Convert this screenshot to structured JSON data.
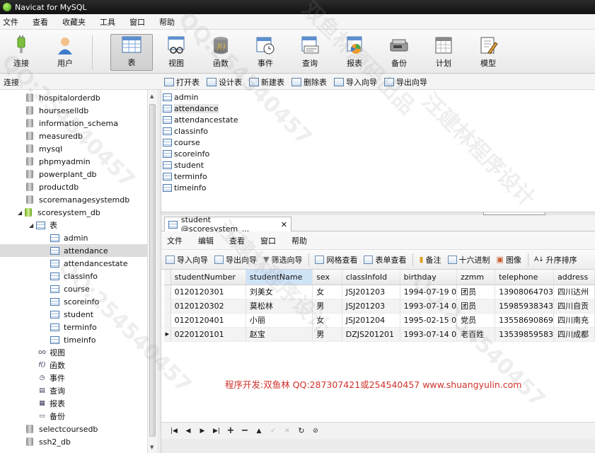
{
  "window": {
    "title": "Navicat for MySQL"
  },
  "menubar": [
    "文件",
    "查看",
    "收藏夹",
    "工具",
    "窗口",
    "帮助"
  ],
  "toolbar": [
    {
      "label": "连接",
      "icon": "plug-icon"
    },
    {
      "label": "用户",
      "icon": "user-icon"
    },
    {
      "label": "表",
      "icon": "table-icon",
      "active": true
    },
    {
      "label": "视图",
      "icon": "view-icon"
    },
    {
      "label": "函数",
      "icon": "function-icon"
    },
    {
      "label": "事件",
      "icon": "event-icon"
    },
    {
      "label": "查询",
      "icon": "query-icon"
    },
    {
      "label": "报表",
      "icon": "report-icon"
    },
    {
      "label": "备份",
      "icon": "backup-icon"
    },
    {
      "label": "计划",
      "icon": "schedule-icon"
    },
    {
      "label": "模型",
      "icon": "model-icon"
    }
  ],
  "left_header": "连接",
  "object_toolbar": [
    "打开表",
    "设计表",
    "新建表",
    "删除表",
    "导入向导",
    "导出向导"
  ],
  "tree": {
    "databases_top": [
      "hospitalorderdb",
      "hourseselldb",
      "information_schema",
      "measuredb",
      "mysql",
      "phpmyadmin",
      "powerplant_db",
      "productdb",
      "scoremanagesystemdb"
    ],
    "open_db": "scoresystem_db",
    "tables_node": "表",
    "tables": [
      "admin",
      "attendance",
      "attendancestate",
      "classinfo",
      "course",
      "scoreinfo",
      "student",
      "terminfo",
      "timeinfo"
    ],
    "selected_table": "attendance",
    "other_nodes": [
      {
        "label": "视图",
        "icon": "glasses-icon"
      },
      {
        "label": "函数",
        "icon": "function-icon"
      },
      {
        "label": "事件",
        "icon": "event-icon"
      },
      {
        "label": "查询",
        "icon": "query-icon"
      },
      {
        "label": "报表",
        "icon": "report-icon"
      },
      {
        "label": "备份",
        "icon": "backup-icon"
      }
    ],
    "databases_bottom": [
      "selectcoursedb",
      "ssh2_db"
    ]
  },
  "object_list": {
    "items": [
      "admin",
      "attendance",
      "attendancestate",
      "classinfo",
      "course",
      "scoreinfo",
      "student",
      "terminfo",
      "timeinfo"
    ],
    "selected": "attendance"
  },
  "inner_window": {
    "tab_title": "student @scoresystem_...",
    "menu": [
      "文件",
      "编辑",
      "查看",
      "窗口",
      "帮助"
    ],
    "toolbar": [
      "导入向导",
      "导出向导",
      "筛选向导",
      "网格查看",
      "表单查看",
      "备注",
      "十六进制",
      "图像",
      "升序排序"
    ]
  },
  "grid": {
    "columns": [
      "studentNumber",
      "studentName",
      "sex",
      "classInfoId",
      "birthday",
      "zzmm",
      "telephone",
      "address"
    ],
    "selected_column": "studentName",
    "rows": [
      [
        "0120120301",
        "刘美女",
        "女",
        "JSJ201203",
        "1994-07-19 0",
        "团员",
        "13908064703",
        "四川达州"
      ],
      [
        "0120120302",
        "莫松林",
        "男",
        "JSJ201203",
        "1993-07-14 0",
        "团员",
        "15985938343",
        "四川自贡"
      ],
      [
        "0120120401",
        "小丽",
        "女",
        "JSJ201204",
        "1995-02-15 0",
        "党员",
        "13558690869",
        "四川南充"
      ],
      [
        "0220120101",
        "赵宝",
        "男",
        "DZJS201201",
        "1993-07-14 0",
        "老百姓",
        "13539859583",
        "四川成都"
      ]
    ],
    "current_row": 3
  },
  "credit": "程序开发:双鱼林 QQ:287307421或254540457 www.shuangyulin.com",
  "watermarks": [
    "汪建林程序设计",
    "双鱼林源码出品",
    "QQ:254540457"
  ]
}
